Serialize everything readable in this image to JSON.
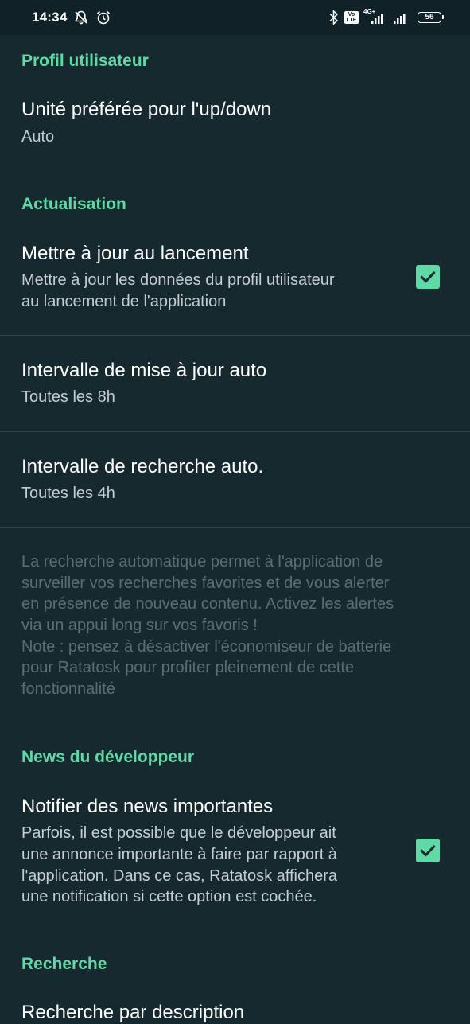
{
  "status_bar": {
    "time": "14:34",
    "network_type": "4G+",
    "volte_top": "Vo",
    "volte_bottom": "LTE",
    "battery": "56",
    "icons": [
      "notifications-off-icon",
      "alarm-icon",
      "bluetooth-icon",
      "volte-icon",
      "signal-icon",
      "signal-icon",
      "battery-icon"
    ]
  },
  "colors": {
    "accent": "#5fd9a6",
    "background": "#15292f",
    "status_bar": "#102228",
    "divider": "#33454b",
    "summary": "#c4cdd0",
    "note": "#5b6e73"
  },
  "sections": {
    "profile": {
      "header": "Profil utilisateur",
      "unit_pref": {
        "title": "Unité préférée pour l'up/down",
        "summary": "Auto"
      }
    },
    "refresh": {
      "header": "Actualisation",
      "update_on_launch": {
        "title": "Mettre à jour au lancement",
        "summary_line1": "Mettre à jour les données du profil utilisateur",
        "summary_line2": "au lancement de l'application",
        "checked": true
      },
      "auto_update_interval": {
        "title": "Intervalle de mise à jour auto",
        "summary": "Toutes les 8h"
      },
      "auto_search_interval": {
        "title": "Intervalle de recherche auto.",
        "summary": "Toutes les 4h"
      },
      "note": {
        "line1": "La recherche automatique permet à l'application de",
        "line2": "surveiller vos recherches favorites et de vous alerter",
        "line3": "en présence de nouveau contenu. Activez les alertes",
        "line4": "via un appui long sur vos favoris !",
        "line5": "Note : pensez à désactiver l'économiseur de batterie",
        "line6": "pour Ratatosk pour profiter pleinement de cette",
        "line7": "fonctionnalité"
      }
    },
    "dev_news": {
      "header": "News du développeur",
      "notify_news": {
        "title": "Notifier des news importantes",
        "summary_line1": "Parfois, il est possible que le développeur ait",
        "summary_line2": "une annonce importante à faire par rapport à",
        "summary_line3": "l'application. Dans ce cas, Ratatosk affichera",
        "summary_line4": "une notification si cette option est cochée.",
        "checked": true
      }
    },
    "search": {
      "header": "Recherche",
      "search_by_description": {
        "title": "Recherche par description"
      }
    }
  }
}
